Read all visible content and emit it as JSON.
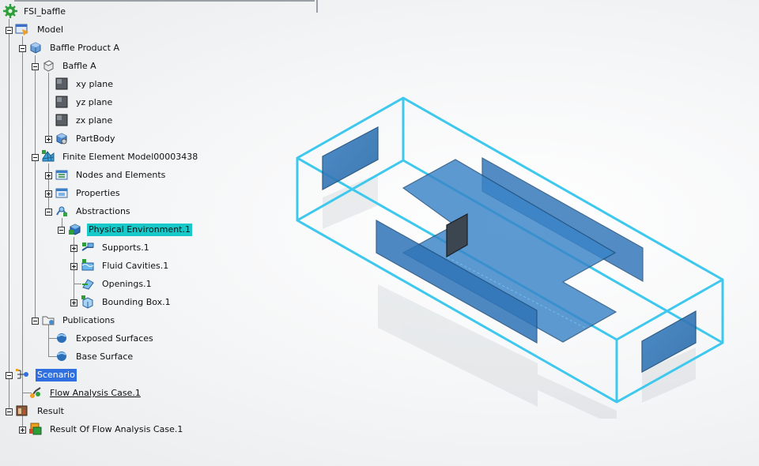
{
  "tree": {
    "root": "FSI_baffle",
    "model": "Model",
    "product": "Baffle Product A",
    "part": "Baffle A",
    "xy_plane": "xy plane",
    "yz_plane": "yz plane",
    "zx_plane": "zx plane",
    "partbody": "PartBody",
    "fem": "Finite Element Model00003438",
    "nodes": "Nodes and Elements",
    "properties": "Properties",
    "abstractions": "Abstractions",
    "physical_env": "Physical Environment.1",
    "supports": "Supports.1",
    "fluid_cavities": "Fluid Cavities.1",
    "openings": "Openings.1",
    "bounding_box": "Bounding Box.1",
    "publications": "Publications",
    "exposed_surfaces": "Exposed Surfaces",
    "base_surface": "Base Surface",
    "scenario": "Scenario",
    "flow_case": "Flow Analysis Case.1",
    "result": "Result",
    "result_of": "Result Of Flow Analysis Case.1"
  },
  "colors": {
    "selection_cyan": "#19c8c8",
    "selection_blue": "#2f6fe0",
    "box_edge": "#3ec8ee",
    "plate_fill": "#2f74b8"
  },
  "icons": {
    "root": "gear-icon",
    "model": "model-icon",
    "product": "product-icon",
    "part": "part-icon",
    "plane": "plane-icon",
    "partbody": "partbody-icon",
    "fem": "fem-icon",
    "folder": "folder-icon",
    "surface": "surface-icon",
    "scenario": "scenario-icon",
    "case": "analysis-case-icon",
    "result": "result-icon"
  }
}
